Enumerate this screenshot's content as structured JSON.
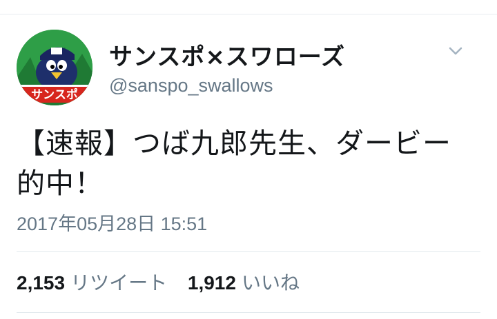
{
  "tweet": {
    "display_name": "サンスポ×スワローズ",
    "handle": "@sanspo_swallows",
    "text_line1": "【速報】つば九郎先生、ダービー",
    "text_line2": "的中！",
    "timestamp": "2017年05月28日 15:51",
    "retweets": {
      "count": "2,153",
      "label": "リツイート"
    },
    "likes": {
      "count": "1,912",
      "label": "いいね"
    },
    "avatar_text": "サンスポ",
    "caret_icon": "chevron-down-icon"
  },
  "colors": {
    "text_primary": "#14171a",
    "text_secondary": "#657786",
    "divider": "#e1e8ed",
    "avatar_bg": "#2b8a3e",
    "avatar_banner": "#d7261e"
  }
}
